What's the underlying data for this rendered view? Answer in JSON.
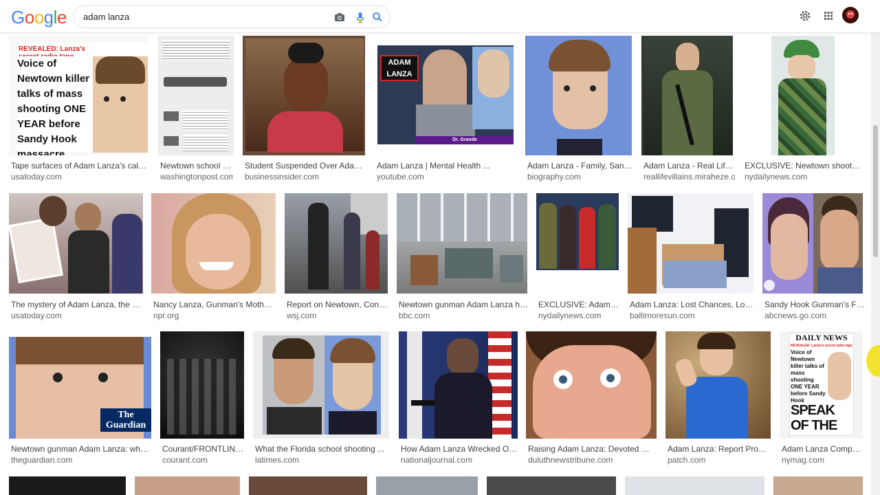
{
  "colors": {
    "google_blue": "#4285F4",
    "google_red": "#EA4335",
    "google_yellow": "#FBBC05",
    "google_green": "#34A853",
    "caption_text": "#3c4043",
    "domain_text": "#5f6368"
  },
  "header": {
    "logo_letters": [
      "G",
      "o",
      "o",
      "g",
      "l",
      "e"
    ],
    "search_value": "adam lanza",
    "icons": [
      "camera-icon",
      "microphone-icon",
      "search-icon",
      "gear-icon",
      "apps-grid-icon",
      "avatar"
    ]
  },
  "results": [
    {
      "caption": "Tape surfaces of Adam Lanza's call to ...",
      "domain": "usatoday.com",
      "thumb_texts": [
        "REVEALED: Lanza's secret radio tape",
        "Voice of Newtown killer talks of mass shooting ONE YEAR before Sandy Hook massacre"
      ],
      "bg": "#d23a2a"
    },
    {
      "caption": "Newtown school sho...",
      "domain": "washingtonpost.com",
      "thumb_texts": [],
      "bg": "#ededed"
    },
    {
      "caption": "Student Suspended Over Adam Lanz...",
      "domain": "businessinsider.com",
      "thumb_texts": [],
      "bg": "#6b4a3a"
    },
    {
      "caption": "Adam Lanza | Mental Health ...",
      "domain": "youtube.com",
      "thumb_texts": [
        "ADAM LANZA",
        "Dr. Grande"
      ],
      "bg": "#3a4a6a"
    },
    {
      "caption": "Adam Lanza - Family, Sandy Ho...",
      "domain": "biography.com",
      "thumb_texts": [],
      "bg": "#6a8ad4"
    },
    {
      "caption": "Adam Lanza - Real Life Vill...",
      "domain": "reallifevillains.miraheze.org",
      "thumb_texts": [],
      "bg": "#2e3a2c"
    },
    {
      "caption": "EXCLUSIVE: Newtown shooter Ada...",
      "domain": "nydailynews.com",
      "thumb_texts": [],
      "bg": "#3f6a3f"
    },
    {
      "caption": "The mystery of Adam Lanza, the Sandy ...",
      "domain": "usatoday.com",
      "thumb_texts": [],
      "bg": "#a08c8c"
    },
    {
      "caption": "Nancy Lanza, Gunman's Mother: Fro...",
      "domain": "npr.org",
      "thumb_texts": [],
      "bg": "#c89a7a"
    },
    {
      "caption": "Report on Newtown, Conn., Sh...",
      "domain": "wsj.com",
      "thumb_texts": [],
      "bg": "#6a6a6a"
    },
    {
      "caption": "Newtown gunman Adam Lanza had ...",
      "domain": "bbc.com",
      "thumb_texts": [],
      "bg": "#8a8a8a"
    },
    {
      "caption": "EXCLUSIVE: Adam Lan...",
      "domain": "nydailynews.com",
      "thumb_texts": [],
      "bg": "#5a5a4a"
    },
    {
      "caption": "Adam Lanza: Lost Chances, Lost Sou...",
      "domain": "baltimoresun.com",
      "thumb_texts": [],
      "bg": "#5a6a8a"
    },
    {
      "caption": "Sandy Hook Gunman's Father...",
      "domain": "abcnews.go.com",
      "thumb_texts": [],
      "bg": "#7a6a8a"
    },
    {
      "caption": "Newtown gunman Adam Lanza: what we k...",
      "domain": "theguardian.com",
      "thumb_texts": [
        "The Guardian"
      ],
      "bg": "#c8a890"
    },
    {
      "caption": "Courant/FRONTLINE In...",
      "domain": "courant.com",
      "thumb_texts": [],
      "bg": "#1a1a1a"
    },
    {
      "caption": "What the Florida school shooting ...",
      "domain": "latimes.com",
      "thumb_texts": [],
      "bg": "#d0d0d0"
    },
    {
      "caption": "How Adam Lanza Wrecked Obama'...",
      "domain": "nationaljournal.com",
      "thumb_texts": [],
      "bg": "#2a3a6a"
    },
    {
      "caption": "Raising Adam Lanza: Devoted mother ...",
      "domain": "duluthnewstribune.com",
      "thumb_texts": [],
      "bg": "#b07a5a"
    },
    {
      "caption": "Adam Lanza: Report Probes D...",
      "domain": "patch.com",
      "thumb_texts": [],
      "bg": "#8a6a4a"
    },
    {
      "caption": "Adam Lanza Compared...",
      "domain": "nymag.com",
      "thumb_texts": [
        "DAILY NEWS",
        "REVEALED: Lanza's secret radio tape",
        "Voice of Newtown killer talks of mass shooting ONE YEAR before Sandy Hook massacre",
        "SPEAK OF THE DEVIL"
      ],
      "bg": "#f4f4f4"
    }
  ]
}
